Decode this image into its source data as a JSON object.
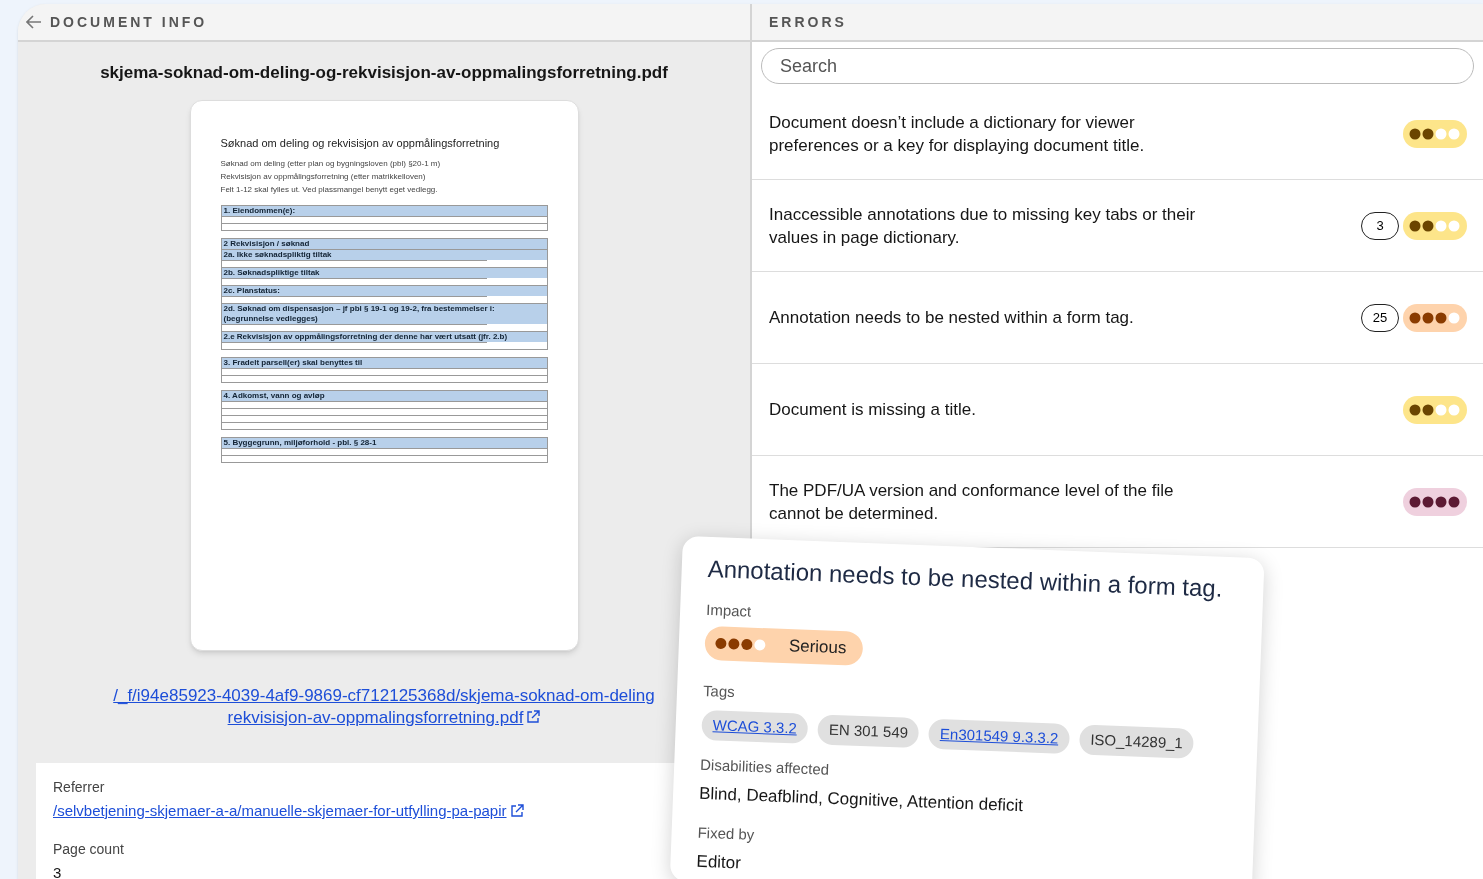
{
  "document_info": {
    "header": "DOCUMENT INFO",
    "filename": "skjema-soknad-om-deling-og-rekvisisjon-av-oppmalingsforretning.pdf",
    "preview": {
      "title": "Søknad om deling og rekvisisjon av oppmålingsforretning",
      "intro": [
        "Søknad om deling (etter plan og bygningsloven (pbl) §20-1 m)",
        "Rekvisisjon av oppmålingsforretning (etter matrikkelloven)",
        "Felt 1-12 skal fylles ut. Ved plassmangel benytt eget vedlegg."
      ],
      "sections": [
        {
          "heading": "1. Eiendommen(e):"
        },
        {
          "heading": "2 Rekvisisjon / søknad",
          "subheadings": [
            "2a. Ikke søknadspliktig tiltak",
            "2b. Søknadspliktige tiltak",
            "2c. Planstatus:",
            "2d. Søknad om dispensasjon – jf pbl § 19-1 og 19-2, fra bestemmelser i: (begrunnelse vedlegges)",
            "2.e Rekvisisjon av oppmålingsforretning der denne har vært utsatt (jfr. 2.b)"
          ]
        },
        {
          "heading": "3. Fradelt parsell(er) skal benyttes til"
        },
        {
          "heading": "4. Adkomst, vann og avløp"
        },
        {
          "heading": "5. Byggegrunn, miljøforhold - pbl. § 28-1"
        }
      ]
    },
    "file_link": [
      "/_f/i94e85923-4039-4af9-9869-cf712125368d/skjema-soknad-om-deling",
      "rekvisisjon-av-oppmalingsforretning.pdf"
    ],
    "fields": [
      {
        "label": "Referrer",
        "value": "/selvbetjening-skjemaer-a-a/manuelle-skjemaer-for-utfylling-pa-papir",
        "kind": "link"
      },
      {
        "label": "Page count",
        "value": "3",
        "kind": "text"
      }
    ]
  },
  "errors": {
    "header": "ERRORS",
    "search": {
      "placeholder": "Search"
    },
    "items": [
      {
        "text": "Document doesn’t include a dictionary for viewer preferences or a key for displaying document title.",
        "stars": 2,
        "color": "#fde58a"
      },
      {
        "text": "Inaccessible annotations due to missing key tabs or their values in page dictionary.",
        "count": "3",
        "stars": 2,
        "color": "#fde58a"
      },
      {
        "text": "Annotation needs to be nested within a form tag.",
        "count": "25",
        "stars": 3,
        "color": "#fed3ac"
      },
      {
        "text": "Document is missing a title.",
        "stars": 2,
        "color": "#fde58a"
      },
      {
        "text": "The PDF/UA version and conformance level of the file cannot be determined.",
        "stars": 4,
        "color": "#efd0de"
      }
    ]
  },
  "detail": {
    "title": "Annotation needs to be nested within a form tag.",
    "impact_label": "Impact",
    "stars": 3,
    "color": "#fed3ac",
    "impact_text": "Serious",
    "tags_label": "Tags",
    "tags": [
      {
        "label": "WCAG 3.3.2",
        "link": true
      },
      {
        "label": "EN 301 549",
        "link": false
      },
      {
        "label": "En301549 9.3.3.2",
        "link": true
      },
      {
        "label": "ISO_14289_1",
        "link": false
      }
    ],
    "disabilities_label": "Disabilities affected",
    "disabilities": "Blind, Deafblind, Cognitive, Attention deficit",
    "fixed_by_label": "Fixed by",
    "fixed_by": "Editor"
  }
}
